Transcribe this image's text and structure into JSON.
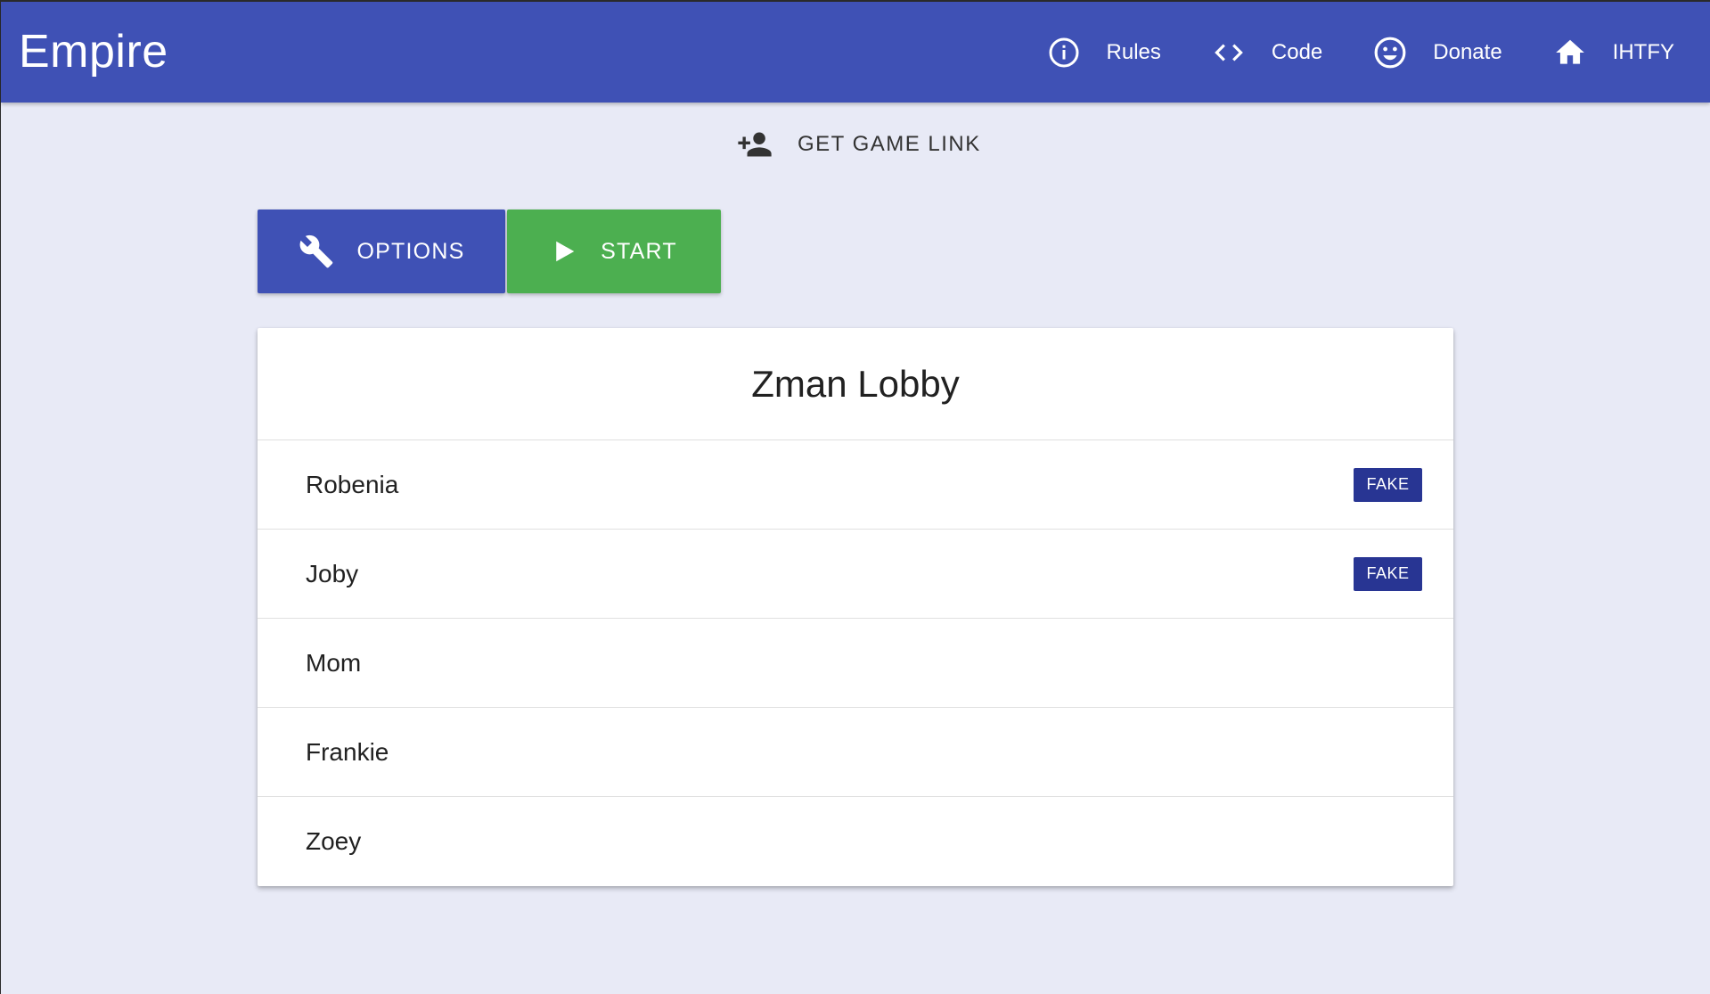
{
  "app": {
    "title": "Empire"
  },
  "nav": {
    "items": [
      {
        "label": "Rules",
        "icon": "info-icon"
      },
      {
        "label": "Code",
        "icon": "code-icon"
      },
      {
        "label": "Donate",
        "icon": "smiley-icon"
      },
      {
        "label": "IHTFY",
        "icon": "home-icon"
      }
    ]
  },
  "actions": {
    "get_game_link": "GET GAME LINK",
    "options": "OPTIONS",
    "start": "START"
  },
  "lobby": {
    "title": "Zman Lobby",
    "players": [
      {
        "name": "Robenia",
        "badge": "FAKE"
      },
      {
        "name": "Joby",
        "badge": "FAKE"
      },
      {
        "name": "Mom",
        "badge": ""
      },
      {
        "name": "Frankie",
        "badge": ""
      },
      {
        "name": "Zoey",
        "badge": ""
      }
    ]
  },
  "colors": {
    "primary": "#3f51b5",
    "start": "#4caf50",
    "badge": "#283593",
    "background": "#e8eaf6"
  }
}
